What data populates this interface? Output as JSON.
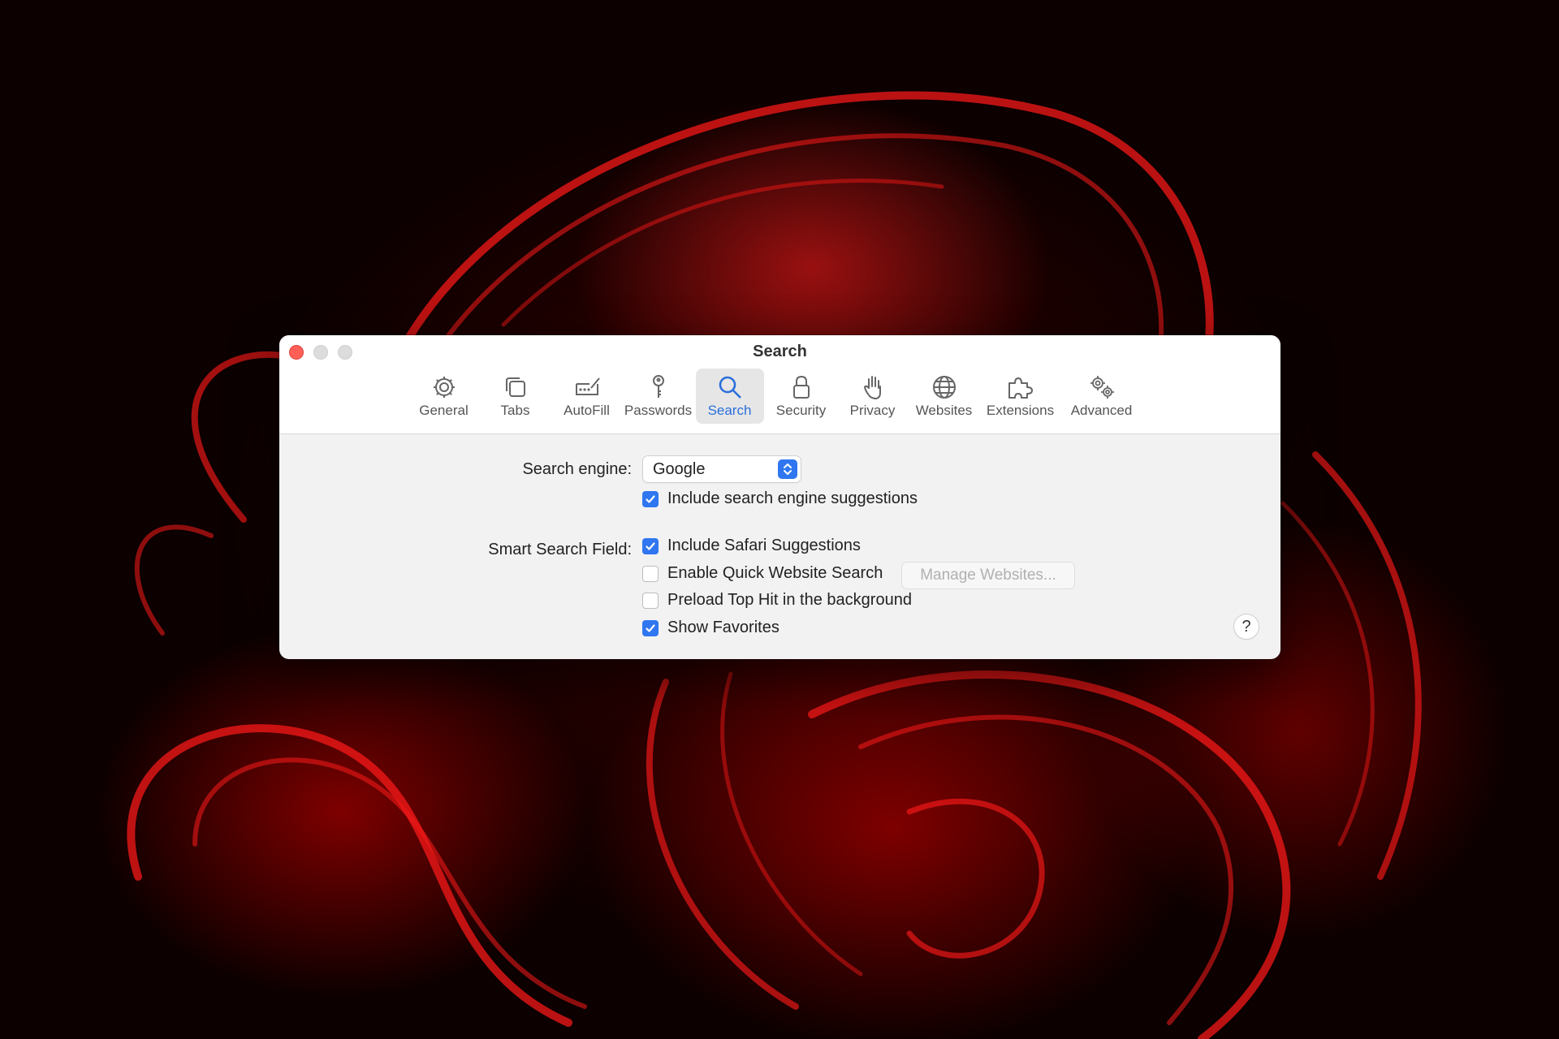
{
  "window": {
    "title": "Search"
  },
  "toolbar": {
    "items": [
      {
        "label": "General",
        "icon": "gear-icon"
      },
      {
        "label": "Tabs",
        "icon": "tabs-icon"
      },
      {
        "label": "AutoFill",
        "icon": "autofill-icon"
      },
      {
        "label": "Passwords",
        "icon": "key-icon"
      },
      {
        "label": "Search",
        "icon": "magnifier-icon",
        "selected": true
      },
      {
        "label": "Security",
        "icon": "lock-icon"
      },
      {
        "label": "Privacy",
        "icon": "hand-icon"
      },
      {
        "label": "Websites",
        "icon": "globe-icon"
      },
      {
        "label": "Extensions",
        "icon": "puzzle-icon"
      },
      {
        "label": "Advanced",
        "icon": "gears-icon"
      }
    ]
  },
  "search": {
    "engine_label": "Search engine:",
    "engine_value": "Google",
    "suggestions": {
      "label": "Include search engine suggestions",
      "checked": true
    }
  },
  "smart_field": {
    "label": "Smart Search Field:",
    "options": [
      {
        "label": "Include Safari Suggestions",
        "checked": true
      },
      {
        "label": "Enable Quick Website Search",
        "checked": false
      },
      {
        "label": "Preload Top Hit in the background",
        "checked": false
      },
      {
        "label": "Show Favorites",
        "checked": true
      }
    ],
    "manage_button": "Manage Websites..."
  },
  "help": {
    "label": "?"
  },
  "colors": {
    "accent": "#2f76f0",
    "close": "#ff5f57",
    "wallpaper": "#b00000"
  }
}
